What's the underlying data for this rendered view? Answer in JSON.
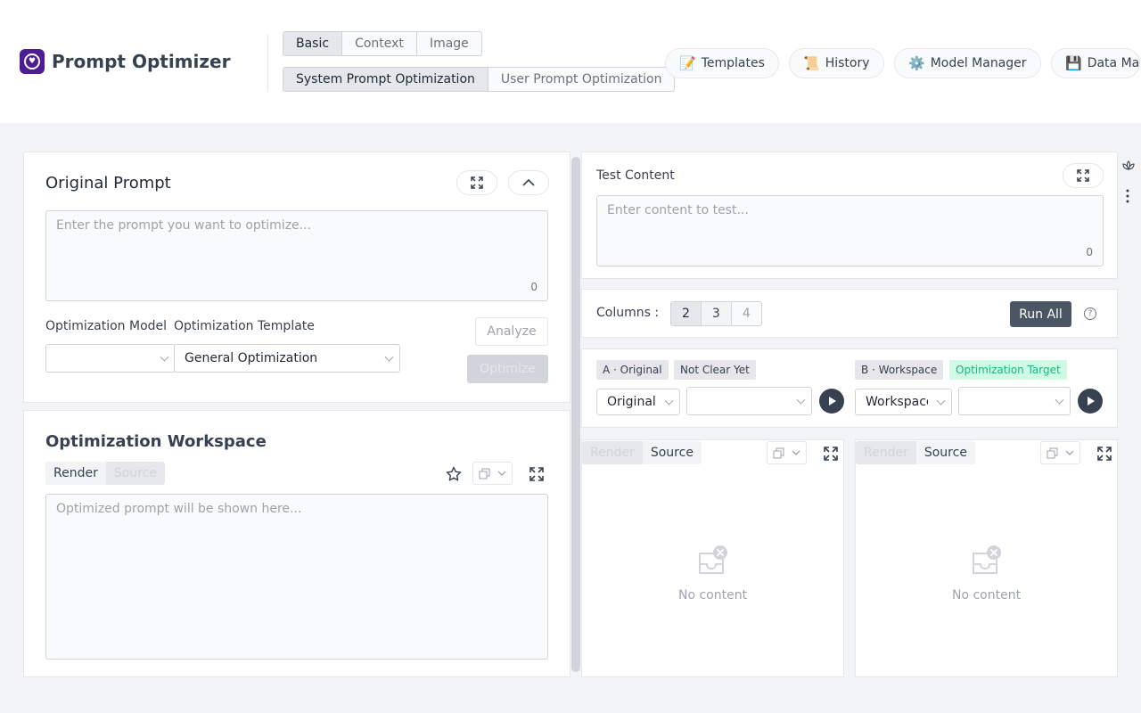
{
  "app": {
    "title": "Prompt Optimizer"
  },
  "header": {
    "mode_tabs": [
      "Basic",
      "Context",
      "Image"
    ],
    "opt_tabs": [
      "System Prompt Optimization",
      "User Prompt Optimization"
    ],
    "buttons": {
      "templates": {
        "icon": "📝",
        "label": "Templates"
      },
      "history": {
        "icon": "📜",
        "label": "History"
      },
      "models": {
        "icon": "⚙️",
        "label": "Model Manager"
      },
      "data": {
        "icon": "💾",
        "label": "Data Ma"
      }
    }
  },
  "original": {
    "title": "Original Prompt",
    "placeholder": "Enter the prompt you want to optimize...",
    "count": "0",
    "model_label": "Optimization Model",
    "model_value": "",
    "template_label": "Optimization Template",
    "template_value": "General Optimization",
    "analyze": "Analyze",
    "optimize": "Optimize"
  },
  "workspace": {
    "title": "Optimization Workspace",
    "tabs": [
      "Render",
      "Source"
    ],
    "placeholder": "Optimized prompt will be shown here..."
  },
  "test": {
    "title": "Test Content",
    "placeholder": "Enter content to test...",
    "count": "0"
  },
  "columns": {
    "label": "Columns :",
    "options": [
      "2",
      "3",
      "4"
    ],
    "run_all": "Run All",
    "help": "?"
  },
  "variants": {
    "a": {
      "tag": "A · Original",
      "status": "Not Clear Yet",
      "select": "Original",
      "model": ""
    },
    "b": {
      "tag": "B · Workspace",
      "status": "Optimization Target",
      "select": "Workspace",
      "model": ""
    }
  },
  "results": {
    "tabs": [
      "Render",
      "Source"
    ],
    "empty": "No content"
  },
  "colors": {
    "brand": "#4c1d95",
    "accent_dark": "#374151",
    "status_green": "#10b981"
  }
}
